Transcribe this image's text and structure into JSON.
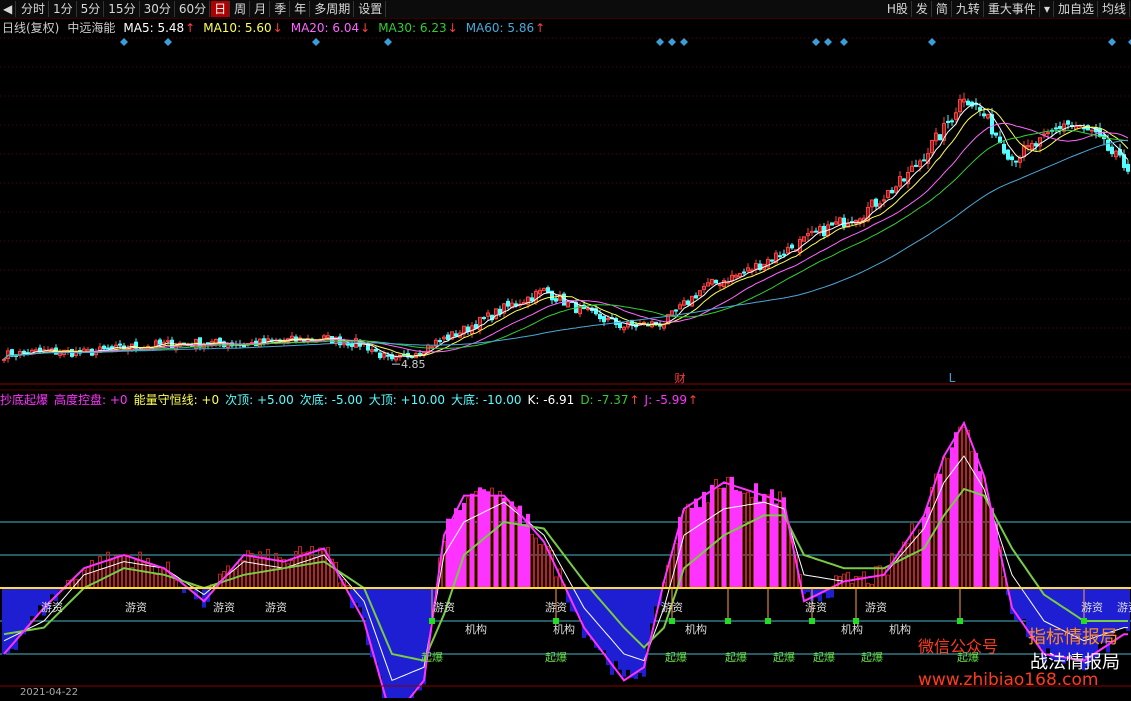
{
  "toolbar": {
    "back_glyph": "◀",
    "left_items": [
      "分时",
      "1分",
      "5分",
      "15分",
      "30分",
      "60分",
      "日",
      "周",
      "月",
      "季",
      "年",
      "多周期",
      "设置"
    ],
    "active": "日",
    "right_items": [
      "H股",
      "发",
      "简",
      "九转",
      "重大事件",
      "▾",
      "加自选",
      "均线"
    ]
  },
  "colors": {
    "up": "#ff4040",
    "down": "#54ffff",
    "ma5": "#ffffff",
    "ma10": "#ffff55",
    "ma20": "#ff66ff",
    "ma30": "#33cc33",
    "ma60": "#4aa8d8",
    "diamond": "#3a9fd8",
    "energy_up": "#ff33ff",
    "energy_down": "#1e1ed2"
  },
  "main_header": {
    "period": "日线(复权)",
    "stock": "中远海能",
    "ma_items": [
      {
        "label": "MA5: 5.48",
        "arrow": "↑",
        "color": "#ffffff"
      },
      {
        "label": "MA10: 5.60",
        "arrow": "↓",
        "color": "#ffff55"
      },
      {
        "label": "MA20: 6.04",
        "arrow": "↓",
        "color": "#ff66ff"
      },
      {
        "label": "MA30: 6.23",
        "arrow": "↓",
        "color": "#33cc33"
      },
      {
        "label": "MA60: 5.86",
        "arrow": "↑",
        "color": "#4aa8d8"
      }
    ]
  },
  "sub_header": {
    "items": [
      {
        "text": "抄底起爆",
        "color": "#ff33ff"
      },
      {
        "text": "高度控盘: +0",
        "color": "#ff33ff"
      },
      {
        "text": "能量守恒线: +0",
        "color": "#ffff55"
      },
      {
        "text": "次顶: +5.00",
        "color": "#54ffff"
      },
      {
        "text": "次底: -5.00",
        "color": "#54ffff"
      },
      {
        "text": "大顶: +10.00",
        "color": "#54ffff"
      },
      {
        "text": "大底: -10.00",
        "color": "#54ffff"
      },
      {
        "text": "K: -6.91",
        "color": "#ffffff"
      },
      {
        "text": "D: -7.37",
        "color": "#33cc33",
        "arrow": "↑"
      },
      {
        "text": "J: -5.99",
        "color": "#ff33ff",
        "arrow": "↑"
      }
    ]
  },
  "chart_data": [
    {
      "type": "candlestick",
      "title": "日线(复权) 中远海能",
      "series": [
        {
          "name": "MA5",
          "values": []
        },
        {
          "name": "MA10",
          "values": []
        },
        {
          "name": "MA20",
          "values": []
        },
        {
          "name": "MA30",
          "values": []
        },
        {
          "name": "MA60",
          "values": []
        }
      ],
      "close_points": [
        [
          0,
          4.95
        ],
        [
          10,
          5.0
        ],
        [
          20,
          4.98
        ],
        [
          30,
          5.05
        ],
        [
          40,
          5.1
        ],
        [
          50,
          5.12
        ],
        [
          60,
          5.1
        ],
        [
          70,
          5.15
        ],
        [
          80,
          5.18
        ],
        [
          90,
          5.1
        ],
        [
          97,
          4.85
        ],
        [
          105,
          5.05
        ],
        [
          115,
          5.3
        ],
        [
          125,
          5.6
        ],
        [
          135,
          5.85
        ],
        [
          145,
          5.55
        ],
        [
          155,
          5.35
        ],
        [
          165,
          5.4
        ],
        [
          175,
          5.9
        ],
        [
          185,
          6.1
        ],
        [
          195,
          6.4
        ],
        [
          205,
          6.7
        ],
        [
          215,
          6.95
        ],
        [
          225,
          7.4
        ],
        [
          235,
          8.1
        ],
        [
          240,
          8.6
        ],
        [
          245,
          8.3
        ],
        [
          252,
          7.7
        ],
        [
          260,
          7.95
        ],
        [
          265,
          8.2
        ],
        [
          272,
          8.05
        ],
        [
          280,
          7.6
        ]
      ],
      "annotations": [
        {
          "label": "4.85",
          "x": 97,
          "value": 4.85
        },
        {
          "label": "财",
          "x": 169
        },
        {
          "label": "L",
          "x": 237
        }
      ],
      "diamond_marks_x": [
        30,
        41,
        78,
        96,
        164,
        167,
        170,
        203,
        206,
        210,
        232,
        277,
        282
      ]
    },
    {
      "type": "bar",
      "title": "抄底起爆",
      "levels": {
        "次顶": 5.0,
        "次底": -5.0,
        "大顶": 10.0,
        "大底": -10.0,
        "能量守恒线": 0
      },
      "ylim": [
        -28,
        28
      ],
      "kdj_points": {
        "K": [
          [
            0,
            -8
          ],
          [
            10,
            -5
          ],
          [
            20,
            2
          ],
          [
            30,
            4
          ],
          [
            40,
            3
          ],
          [
            50,
            -1
          ],
          [
            60,
            4
          ],
          [
            70,
            3
          ],
          [
            80,
            5
          ],
          [
            90,
            -2
          ],
          [
            97,
            -14
          ],
          [
            105,
            -12
          ],
          [
            110,
            5
          ],
          [
            115,
            10
          ],
          [
            125,
            13
          ],
          [
            135,
            8
          ],
          [
            145,
            -3
          ],
          [
            155,
            -10
          ],
          [
            160,
            -11
          ],
          [
            165,
            -3
          ],
          [
            170,
            8
          ],
          [
            180,
            12
          ],
          [
            190,
            13
          ],
          [
            195,
            12
          ],
          [
            200,
            2
          ],
          [
            210,
            1
          ],
          [
            220,
            2
          ],
          [
            230,
            9
          ],
          [
            235,
            16
          ],
          [
            240,
            20
          ],
          [
            245,
            15
          ],
          [
            252,
            2
          ],
          [
            260,
            -5
          ],
          [
            270,
            -8
          ],
          [
            280,
            -6
          ]
        ],
        "D": [
          [
            0,
            -7
          ],
          [
            10,
            -6
          ],
          [
            20,
            0
          ],
          [
            30,
            3
          ],
          [
            40,
            2
          ],
          [
            50,
            0
          ],
          [
            60,
            2
          ],
          [
            70,
            3
          ],
          [
            80,
            4
          ],
          [
            90,
            0
          ],
          [
            97,
            -10
          ],
          [
            105,
            -11
          ],
          [
            110,
            -4
          ],
          [
            115,
            5
          ],
          [
            125,
            10
          ],
          [
            135,
            9
          ],
          [
            145,
            1
          ],
          [
            155,
            -6
          ],
          [
            160,
            -9
          ],
          [
            165,
            -6
          ],
          [
            170,
            3
          ],
          [
            180,
            8
          ],
          [
            190,
            11
          ],
          [
            195,
            11
          ],
          [
            200,
            5
          ],
          [
            210,
            3
          ],
          [
            220,
            3
          ],
          [
            230,
            6
          ],
          [
            235,
            11
          ],
          [
            240,
            15
          ],
          [
            245,
            14
          ],
          [
            252,
            6
          ],
          [
            260,
            -1
          ],
          [
            270,
            -5
          ],
          [
            280,
            -5
          ]
        ],
        "J": [
          [
            0,
            -10
          ],
          [
            10,
            -3
          ],
          [
            20,
            3
          ],
          [
            30,
            5
          ],
          [
            40,
            3
          ],
          [
            50,
            -2
          ],
          [
            60,
            5
          ],
          [
            70,
            4
          ],
          [
            80,
            6
          ],
          [
            90,
            -5
          ],
          [
            97,
            -20
          ],
          [
            105,
            -14
          ],
          [
            110,
            8
          ],
          [
            115,
            14
          ],
          [
            125,
            14
          ],
          [
            135,
            7
          ],
          [
            145,
            -6
          ],
          [
            155,
            -14
          ],
          [
            160,
            -12
          ],
          [
            165,
            1
          ],
          [
            170,
            12
          ],
          [
            180,
            16
          ],
          [
            190,
            14
          ],
          [
            195,
            13
          ],
          [
            200,
            -2
          ],
          [
            210,
            1
          ],
          [
            220,
            2
          ],
          [
            230,
            11
          ],
          [
            235,
            20
          ],
          [
            240,
            25
          ],
          [
            245,
            17
          ],
          [
            252,
            -3
          ],
          [
            260,
            -10
          ],
          [
            270,
            -11
          ],
          [
            280,
            -7
          ]
        ]
      },
      "signals": [
        {
          "label": "游资",
          "x": 12
        },
        {
          "label": "游资",
          "x": 33
        },
        {
          "label": "游资",
          "x": 55
        },
        {
          "label": "游资",
          "x": 68
        },
        {
          "label": "游资",
          "x": 110
        },
        {
          "label": "游资",
          "x": 138
        },
        {
          "label": "游资",
          "x": 167
        },
        {
          "label": "游资",
          "x": 203
        },
        {
          "label": "游资",
          "x": 218
        },
        {
          "label": "游资",
          "x": 272
        },
        {
          "label": "游资",
          "x": 281
        },
        {
          "label": "机构",
          "x": 118
        },
        {
          "label": "机构",
          "x": 140
        },
        {
          "label": "机构",
          "x": 173
        },
        {
          "label": "机构",
          "x": 212
        },
        {
          "label": "机构",
          "x": 224
        },
        {
          "label": "起爆",
          "x": 107
        },
        {
          "label": "起爆",
          "x": 138
        },
        {
          "label": "起爆",
          "x": 168
        },
        {
          "label": "起爆",
          "x": 183
        },
        {
          "label": "起爆",
          "x": 195
        },
        {
          "label": "起爆",
          "x": 205
        },
        {
          "label": "起爆",
          "x": 217
        },
        {
          "label": "起爆",
          "x": 241
        }
      ],
      "baseline_marks_x": [
        107,
        138,
        167,
        181,
        191,
        202,
        213,
        239,
        270
      ]
    }
  ],
  "watermarks": {
    "w1": "微信公众号",
    "w2": "指标情报局",
    "w3": "战法情报局",
    "w4": "www.zhibiao168.com"
  },
  "bottom_date": "2021-04-22"
}
